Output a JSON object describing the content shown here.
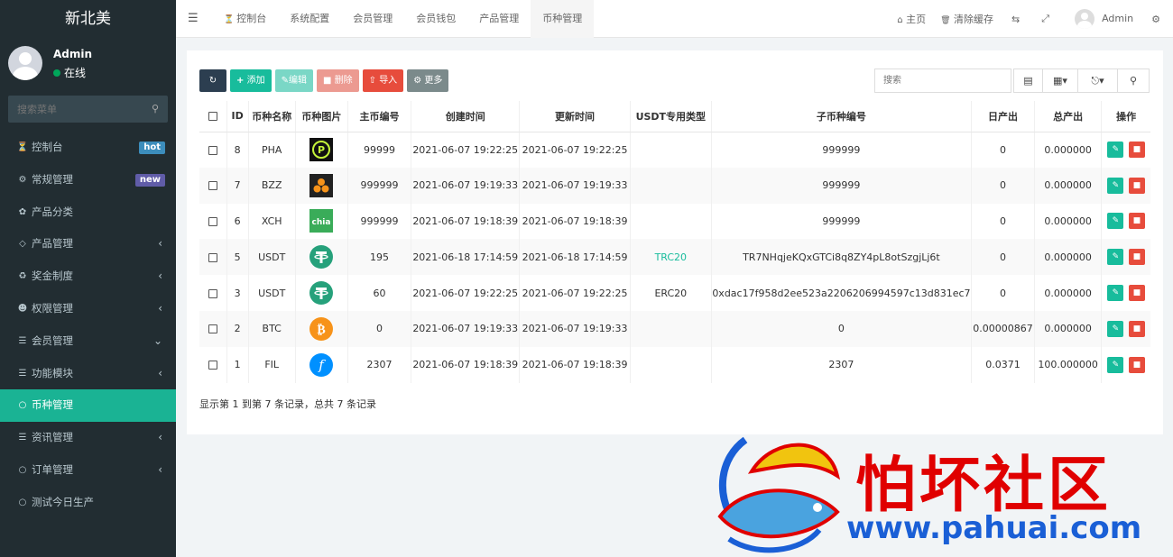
{
  "brand": "新北美",
  "user": {
    "name": "Admin",
    "status": "在线"
  },
  "sidebar": {
    "search_placeholder": "搜索菜单",
    "items": [
      {
        "icon": "dashboard-icon",
        "label": "控制台",
        "badge": "hot",
        "badge_color": "#3c8dbc"
      },
      {
        "icon": "cogs-icon",
        "label": "常规管理",
        "badge": "new",
        "badge_color": "#605ca8"
      },
      {
        "icon": "leaf-icon",
        "label": "产品分类"
      },
      {
        "icon": "diamond-icon",
        "label": "产品管理",
        "caret": "‹"
      },
      {
        "icon": "recycle-icon",
        "label": "奖金制度",
        "caret": "‹"
      },
      {
        "icon": "group-icon",
        "label": "权限管理",
        "caret": "‹"
      },
      {
        "icon": "list-icon",
        "label": "会员管理",
        "caret": "⌄"
      },
      {
        "icon": "list-icon",
        "label": "功能模块",
        "caret": "‹"
      },
      {
        "icon": "circle-icon",
        "label": "币种管理",
        "active": true
      },
      {
        "icon": "list-icon",
        "label": "资讯管理",
        "caret": "‹"
      },
      {
        "icon": "circle-icon",
        "label": "订单管理",
        "caret": "‹"
      },
      {
        "icon": "circle-icon",
        "label": "测试今日生产"
      }
    ]
  },
  "header": {
    "tabs": [
      {
        "icon": "dashboard-icon",
        "label": "控制台"
      },
      {
        "label": "系统配置"
      },
      {
        "label": "会员管理"
      },
      {
        "label": "会员钱包"
      },
      {
        "label": "产品管理"
      },
      {
        "label": "币种管理",
        "active": true
      }
    ],
    "home": "主页",
    "clear_cache": "清除缓存",
    "admin": "Admin"
  },
  "toolbar": {
    "add": "添加",
    "edit": "编辑",
    "delete": "删除",
    "import": "导入",
    "more": "更多",
    "search_placeholder": "搜索"
  },
  "table": {
    "columns": [
      "ID",
      "币种名称",
      "币种图片",
      "主币编号",
      "创建时间",
      "更新时间",
      "USDT专用类型",
      "子币种编号",
      "日产出",
      "总产出",
      "操作"
    ],
    "rows": [
      {
        "id": "8",
        "name": "PHA",
        "icon": "pha-coin-icon",
        "main_no": "99999",
        "created": "2021-06-07 19:22:25",
        "updated": "2021-06-07 19:22:25",
        "usdt_type": "",
        "sub_no": "999999",
        "daily": "0",
        "total": "0.000000"
      },
      {
        "id": "7",
        "name": "BZZ",
        "icon": "bzz-coin-icon",
        "main_no": "999999",
        "created": "2021-06-07 19:19:33",
        "updated": "2021-06-07 19:19:33",
        "usdt_type": "",
        "sub_no": "999999",
        "daily": "0",
        "total": "0.000000"
      },
      {
        "id": "6",
        "name": "XCH",
        "icon": "chia-coin-icon",
        "main_no": "999999",
        "created": "2021-06-07 19:18:39",
        "updated": "2021-06-07 19:18:39",
        "usdt_type": "",
        "sub_no": "999999",
        "daily": "0",
        "total": "0.000000"
      },
      {
        "id": "5",
        "name": "USDT",
        "icon": "tether-coin-icon",
        "main_no": "195",
        "created": "2021-06-18 17:14:59",
        "updated": "2021-06-18 17:14:59",
        "usdt_type": "TRC20",
        "usdt_type_color": "#18bc9c",
        "sub_no": "TR7NHqjeKQxGTCi8q8ZY4pL8otSzgjLj6t",
        "daily": "0",
        "total": "0.000000"
      },
      {
        "id": "3",
        "name": "USDT",
        "icon": "tether-coin-icon",
        "main_no": "60",
        "created": "2021-06-07 19:22:25",
        "updated": "2021-06-07 19:22:25",
        "usdt_type": "ERC20",
        "sub_no": "0xdac17f958d2ee523a2206206994597c13d831ec7",
        "daily": "0",
        "total": "0.000000"
      },
      {
        "id": "2",
        "name": "BTC",
        "icon": "bitcoin-coin-icon",
        "main_no": "0",
        "created": "2021-06-07 19:19:33",
        "updated": "2021-06-07 19:19:33",
        "usdt_type": "",
        "sub_no": "0",
        "daily": "0.00000867",
        "total": "0.000000"
      },
      {
        "id": "1",
        "name": "FIL",
        "icon": "filecoin-coin-icon",
        "main_no": "2307",
        "created": "2021-06-07 19:18:39",
        "updated": "2021-06-07 19:18:39",
        "usdt_type": "",
        "sub_no": "2307",
        "daily": "0.0371",
        "total": "100.000000"
      }
    ]
  },
  "pager": "显示第 1 到第 7 条记录，总共 7 条记录",
  "watermark": {
    "text": "怕坏社区",
    "url": "www.pahuai.com"
  }
}
